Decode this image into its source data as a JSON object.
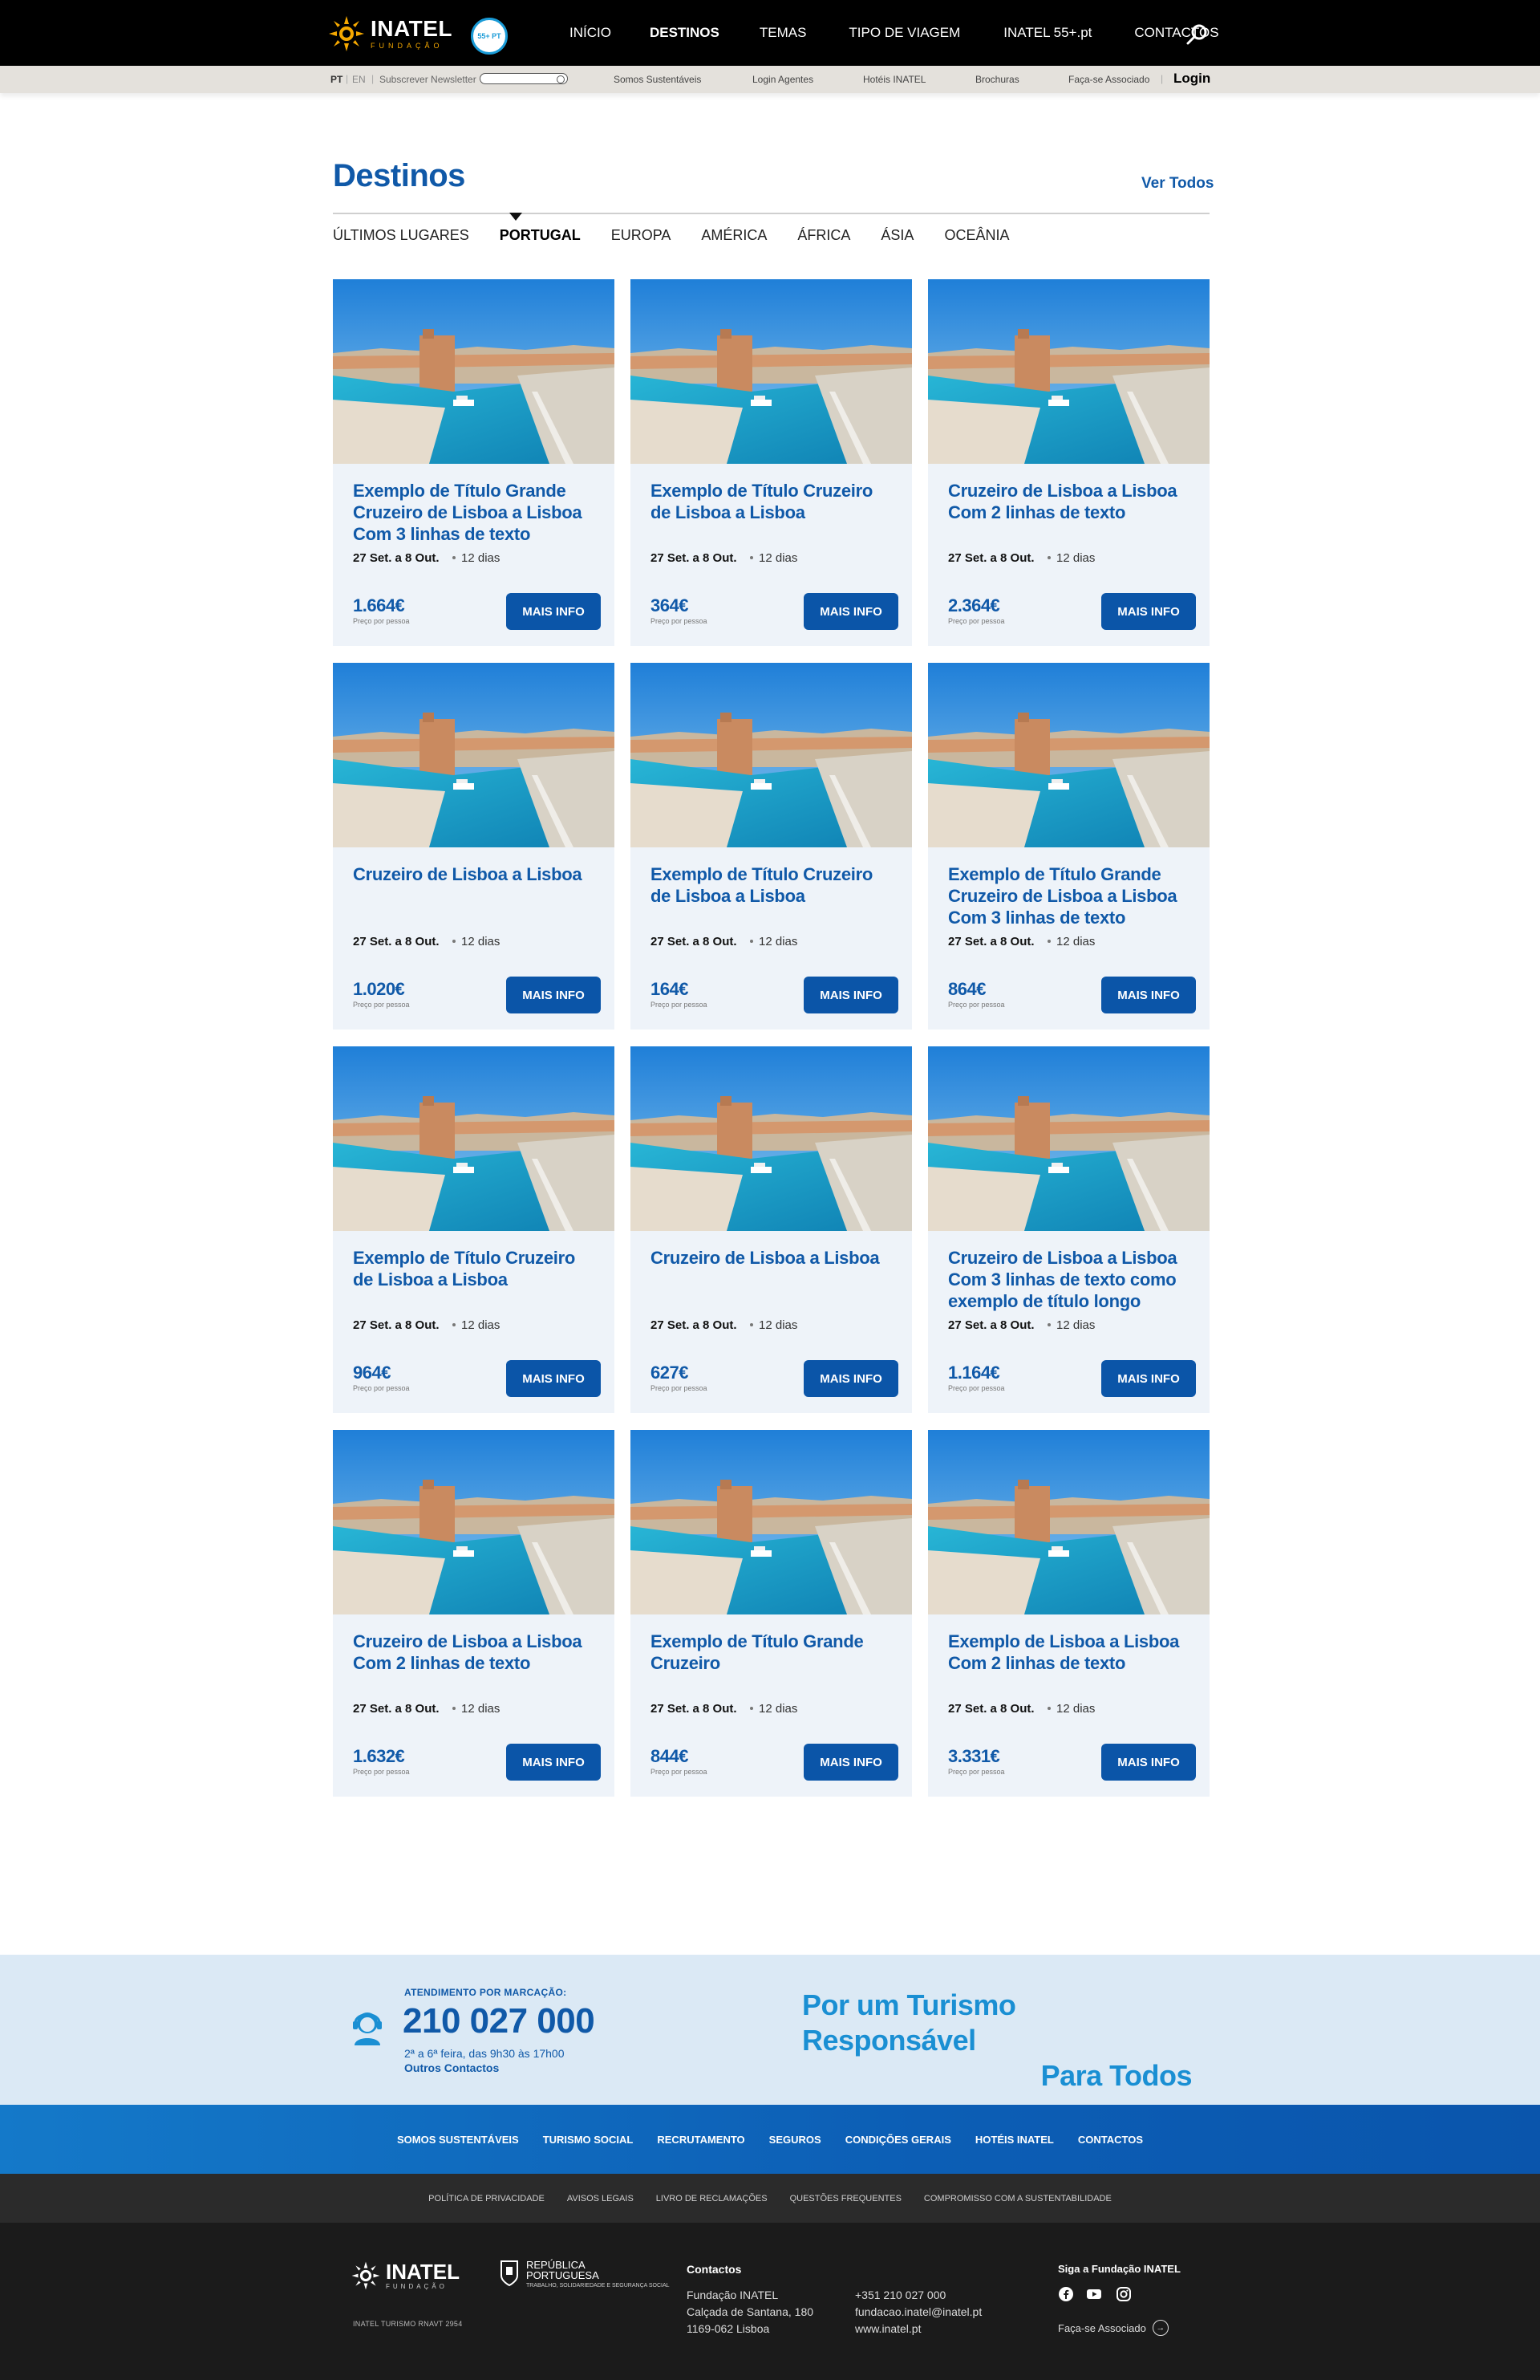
{
  "header": {
    "brand": "INATEL",
    "brand_sub": "FUNDAÇÃO",
    "badge": "55+ PT",
    "nav": [
      "INÍCIO",
      "DESTINOS",
      "TEMAS",
      "TIPO DE VIAGEM",
      "INATEL 55+.pt",
      "CONTACTOS"
    ],
    "active_nav": "DESTINOS",
    "colors": {
      "background": "#000000",
      "accent": "#f5a800"
    }
  },
  "subbar": {
    "lang_pt": "PT",
    "lang_en": "EN",
    "newsletter_label": "Subscrever Newsletter",
    "links": [
      "Somos Sustentáveis",
      "Login Agentes",
      "Hotéis INATEL",
      "Brochuras",
      "Faça-se Associado"
    ],
    "login": "Login"
  },
  "section": {
    "title": "Destinos",
    "view_all": "Ver Todos",
    "tabs": [
      "ÚLTIMOS LUGARES",
      "PORTUGAL",
      "EUROPA",
      "AMÉRICA",
      "ÁFRICA",
      "ÁSIA",
      "OCEÂNIA"
    ],
    "active_tab": "PORTUGAL"
  },
  "card_common": {
    "dates": "27 Set. a 8 Out.",
    "days": "12 dias",
    "price_note": "Preço por pessoa",
    "button": "MAIS INFO"
  },
  "cards": [
    {
      "title": "Exemplo de Título Grande Cruzeiro de Lisboa a Lisboa Com 3 linhas de texto",
      "price": "1.664€"
    },
    {
      "title": "Exemplo de Título Cruzeiro de Lisboa a Lisboa",
      "price": "364€"
    },
    {
      "title": "Cruzeiro de Lisboa a Lisboa Com 2 linhas de texto",
      "price": "2.364€"
    },
    {
      "title": "Cruzeiro de Lisboa a Lisboa",
      "price": "1.020€"
    },
    {
      "title": "Exemplo de Título Cruzeiro de Lisboa a Lisboa",
      "price": "164€"
    },
    {
      "title": "Exemplo de Título Grande Cruzeiro de Lisboa a Lisboa Com 3 linhas de texto",
      "price": "864€"
    },
    {
      "title": "Exemplo de Título Cruzeiro de Lisboa a Lisboa",
      "price": "964€"
    },
    {
      "title": "Cruzeiro de Lisboa a Lisboa",
      "price": "627€"
    },
    {
      "title": "Cruzeiro de Lisboa a Lisboa Com 3 linhas de texto como exemplo de título longo",
      "price": "1.164€"
    },
    {
      "title": "Cruzeiro de Lisboa a Lisboa Com 2 linhas de texto",
      "price": "1.632€"
    },
    {
      "title": "Exemplo de Título Grande Cruzeiro",
      "price": "844€"
    },
    {
      "title": "Exemplo de Lisboa a Lisboa Com 2 linhas de texto",
      "price": "3.331€"
    }
  ],
  "contact": {
    "label": "ATENDIMENTO POR MARCAÇÃO:",
    "phone": "210 027 000",
    "hours": "2ª a 6ª feira, das 9h30 às 17h00",
    "other": "Outros Contactos",
    "tagline_1": "Por um Turismo Responsável",
    "tagline_2": "Para Todos"
  },
  "footer_nav": [
    "SOMOS SUSTENTÁVEIS",
    "TURISMO SOCIAL",
    "RECRUTAMENTO",
    "SEGUROS",
    "CONDIÇÕES GERAIS",
    "HOTÉIS INATEL",
    "CONTACTOS"
  ],
  "legal": [
    "POLÍTICA DE PRIVACIDADE",
    "AVISOS LEGAIS",
    "LIVRO DE RECLAMAÇÕES",
    "QUESTÕES FREQUENTES",
    "COMPROMISSO COM A SUSTENTABILIDADE"
  ],
  "footer": {
    "brand": "INATEL",
    "brand_sub": "FUNDAÇÃO",
    "rnavt": "INATEL TURISMO RNAVT 2954",
    "republica_1": "REPÚBLICA",
    "republica_2": "PORTUGUESA",
    "republica_sub": "TRABALHO, SOLIDARIEDADE E SEGURANÇA SOCIAL",
    "contacts_title": "Contactos",
    "address_1": "Fundação INATEL",
    "address_2": "Calçada de Santana, 180",
    "address_3": "1169-062 Lisboa",
    "phone": "+351 210 027 000",
    "email": "fundacao.inatel@inatel.pt",
    "website": "www.inatel.pt",
    "follow": "Siga a Fundação INATEL",
    "social": [
      "facebook-icon",
      "youtube-icon",
      "instagram-icon"
    ],
    "associate": "Faça-se Associado"
  }
}
